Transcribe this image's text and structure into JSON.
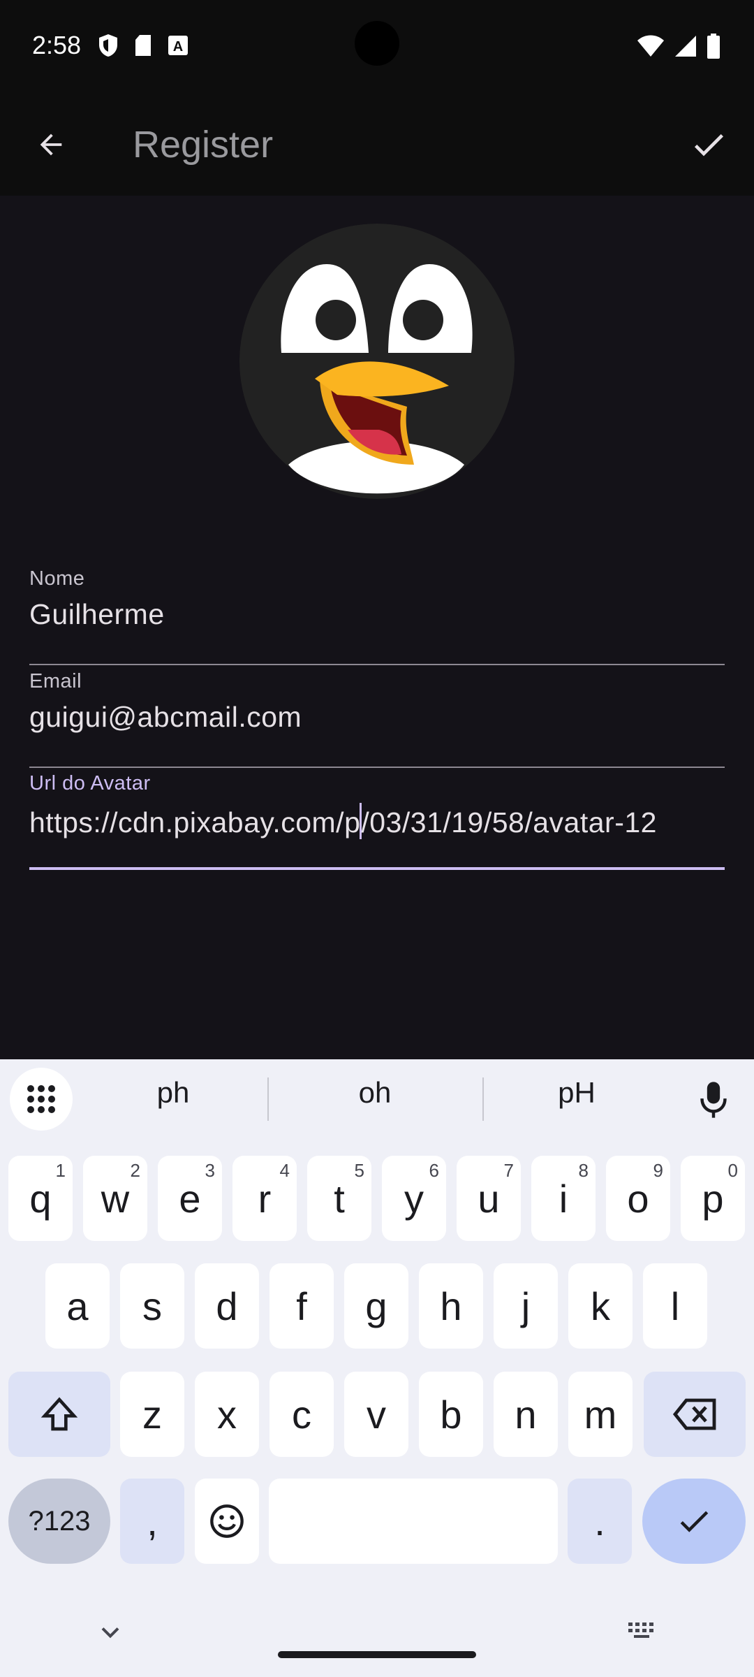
{
  "status": {
    "time": "2:58",
    "left_icons": [
      "shield-icon",
      "sd-card-icon",
      "font-icon"
    ],
    "right_icons": [
      "wifi-icon",
      "signal-icon",
      "battery-icon"
    ]
  },
  "app_bar": {
    "title": "Register",
    "back_icon": "arrow-back-icon",
    "confirm_icon": "check-icon"
  },
  "avatar": {
    "description_icon": "penguin-avatar"
  },
  "form": {
    "name": {
      "label": "Nome",
      "value": "Guilherme"
    },
    "email": {
      "label": "Email",
      "value": "guigui@abcmail.com"
    },
    "avatar_url": {
      "label": "Url do Avatar",
      "value_before_caret": "https://cdn.pixabay.com/p",
      "value_after_caret": "/03/31/19/58/avatar-12"
    }
  },
  "keyboard": {
    "suggestions": [
      "ph",
      "oh",
      "pH"
    ],
    "row1": [
      {
        "k": "q",
        "h": "1"
      },
      {
        "k": "w",
        "h": "2"
      },
      {
        "k": "e",
        "h": "3"
      },
      {
        "k": "r",
        "h": "4"
      },
      {
        "k": "t",
        "h": "5"
      },
      {
        "k": "y",
        "h": "6"
      },
      {
        "k": "u",
        "h": "7"
      },
      {
        "k": "i",
        "h": "8"
      },
      {
        "k": "o",
        "h": "9"
      },
      {
        "k": "p",
        "h": "0"
      }
    ],
    "row2": [
      "a",
      "s",
      "d",
      "f",
      "g",
      "h",
      "j",
      "k",
      "l"
    ],
    "row3": [
      "z",
      "x",
      "c",
      "v",
      "b",
      "n",
      "m"
    ],
    "symbols_label": "?123",
    "comma_label": ",",
    "period_label": "."
  },
  "colors": {
    "background": "#141218",
    "accent": "#cdbdf3",
    "keyboard_bg": "#eff0f7"
  }
}
